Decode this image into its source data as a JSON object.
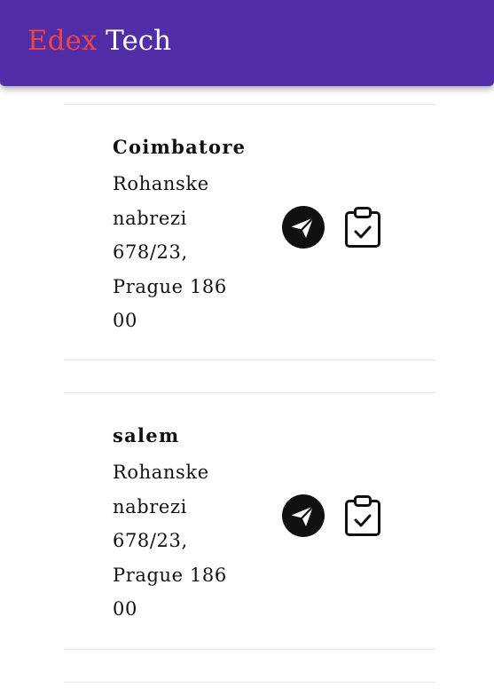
{
  "header": {
    "brand_part1": "Edex",
    "brand_part2": "Tech",
    "background_color": "#512da8",
    "brand_accent_color": "#ef4444"
  },
  "locations": [
    {
      "name": "Coimbatore",
      "address_lines": [
        "Rohanske",
        "nabrezi",
        "678/23,",
        "Prague 186",
        "00"
      ],
      "actions": [
        "send-icon",
        "clipboard-check-icon"
      ]
    },
    {
      "name": "salem",
      "address_lines": [
        "Rohanske",
        "nabrezi",
        "678/23,",
        "Prague 186",
        "00"
      ],
      "actions": [
        "send-icon",
        "clipboard-check-icon"
      ]
    }
  ]
}
